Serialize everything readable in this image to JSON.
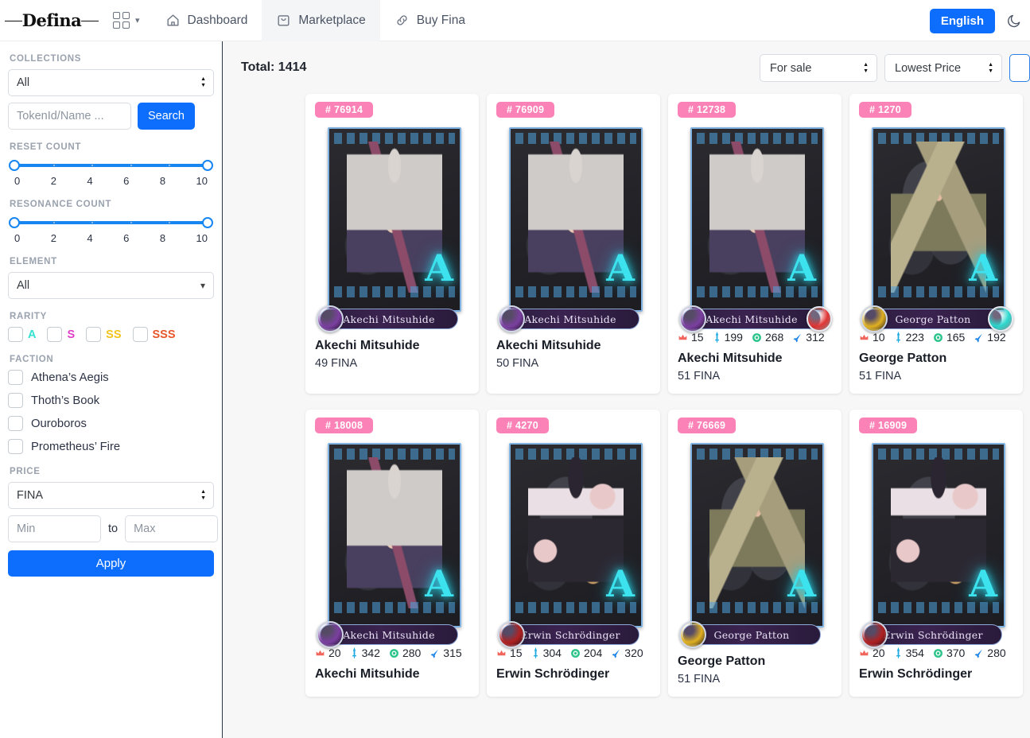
{
  "brand": {
    "name": "Defina"
  },
  "nav": {
    "apps_icon": "grid-icon",
    "chevron_icon": "chevron-down-icon",
    "items": [
      {
        "label": "Dashboard",
        "icon": "home-icon",
        "active": false
      },
      {
        "label": "Marketplace",
        "icon": "bag-icon",
        "active": true
      },
      {
        "label": "Buy Fina",
        "icon": "link-icon",
        "active": false
      }
    ],
    "language_button": "English",
    "theme_toggle_icon": "moon-icon",
    "accent_color": "#0d6efd"
  },
  "sidebar": {
    "collections": {
      "label": "COLLECTIONS",
      "value": "All"
    },
    "search": {
      "placeholder": "TokenId/Name ...",
      "value": "",
      "button": "Search"
    },
    "reset_count": {
      "label": "RESET COUNT",
      "min": 0,
      "max": 10,
      "ticks": [
        "0",
        "2",
        "4",
        "6",
        "8",
        "10"
      ]
    },
    "resonance_count": {
      "label": "RESONANCE COUNT",
      "min": 0,
      "max": 10,
      "ticks": [
        "0",
        "2",
        "4",
        "6",
        "8",
        "10"
      ]
    },
    "element": {
      "label": "ELEMENT",
      "value": "All"
    },
    "rarity": {
      "label": "RARITY",
      "options": [
        {
          "tag": "A",
          "color": "#34e0d2",
          "checked": false
        },
        {
          "tag": "S",
          "color": "#e040c8",
          "checked": false
        },
        {
          "tag": "SS",
          "color": "#f0c419",
          "checked": false
        },
        {
          "tag": "SSS",
          "color": "#e8562a",
          "checked": false
        }
      ]
    },
    "faction": {
      "label": "FACTION",
      "options": [
        {
          "label": "Athena’s Aegis",
          "checked": false
        },
        {
          "label": "Thoth’s Book",
          "checked": false
        },
        {
          "label": "Ouroboros",
          "checked": false
        },
        {
          "label": "Prometheus’ Fire",
          "checked": false
        }
      ]
    },
    "price": {
      "label": "PRICE",
      "currency": "FINA",
      "min_placeholder": "Min",
      "max_placeholder": "Max",
      "to_label": "to",
      "apply_label": "Apply"
    }
  },
  "main": {
    "total_label": "Total: 1414",
    "status_filter": "For sale",
    "sort_filter": "Lowest Price",
    "stat_icons": {
      "level": "crown-icon",
      "attack": "sword-icon",
      "defense": "shield-target-icon",
      "speed": "lightning-icon"
    },
    "stat_colors": {
      "level": "#f2655d",
      "attack": "#1aa8e0",
      "defense": "#2bc48a",
      "speed": "#1f85e8"
    },
    "cards": [
      {
        "id": "# 76914",
        "name": "Akechi Mitsuhide",
        "price": "49 FINA",
        "rank": "A",
        "art": "akechi",
        "faction_orb": "#7b3fa0",
        "elem_orb": "none",
        "stats": null
      },
      {
        "id": "# 76909",
        "name": "Akechi Mitsuhide",
        "price": "50 FINA",
        "rank": "A",
        "art": "akechi",
        "faction_orb": "#7b3fa0",
        "elem_orb": "none",
        "stats": null
      },
      {
        "id": "# 12738",
        "name": "Akechi Mitsuhide",
        "price": "51 FINA",
        "rank": "A",
        "art": "akechi",
        "faction_orb": "#7b3fa0",
        "elem_orb": "#e03535",
        "stats": {
          "level": "15",
          "attack": "199",
          "defense": "268",
          "speed": "312"
        }
      },
      {
        "id": "# 1270",
        "name": "George Patton",
        "price": "51 FINA",
        "rank": "A",
        "art": "patton",
        "faction_orb": "#e0b021",
        "elem_orb": "#2bd8cf",
        "stats": {
          "level": "10",
          "attack": "223",
          "defense": "165",
          "speed": "192"
        }
      },
      {
        "id": "# 18008",
        "name": "Akechi Mitsuhide",
        "price": "",
        "rank": "A",
        "art": "akechi",
        "faction_orb": "#7b3fa0",
        "elem_orb": "none",
        "stats": {
          "level": "20",
          "attack": "342",
          "defense": "280",
          "speed": "315"
        }
      },
      {
        "id": "# 4270",
        "name": "Erwin Schrödinger",
        "price": "",
        "rank": "A",
        "art": "erwin",
        "faction_orb": "#b02020",
        "elem_orb": "none",
        "stats": {
          "level": "15",
          "attack": "304",
          "defense": "204",
          "speed": "320"
        }
      },
      {
        "id": "# 76669",
        "name": "George Patton",
        "price": "51 FINA",
        "rank": "A",
        "art": "patton",
        "faction_orb": "#e0b021",
        "elem_orb": "none",
        "stats": null
      },
      {
        "id": "# 16909",
        "name": "Erwin Schrödinger",
        "price": "",
        "rank": "A",
        "art": "erwin",
        "faction_orb": "#b02020",
        "elem_orb": "none",
        "stats": {
          "level": "20",
          "attack": "354",
          "defense": "370",
          "speed": "280"
        }
      }
    ]
  }
}
